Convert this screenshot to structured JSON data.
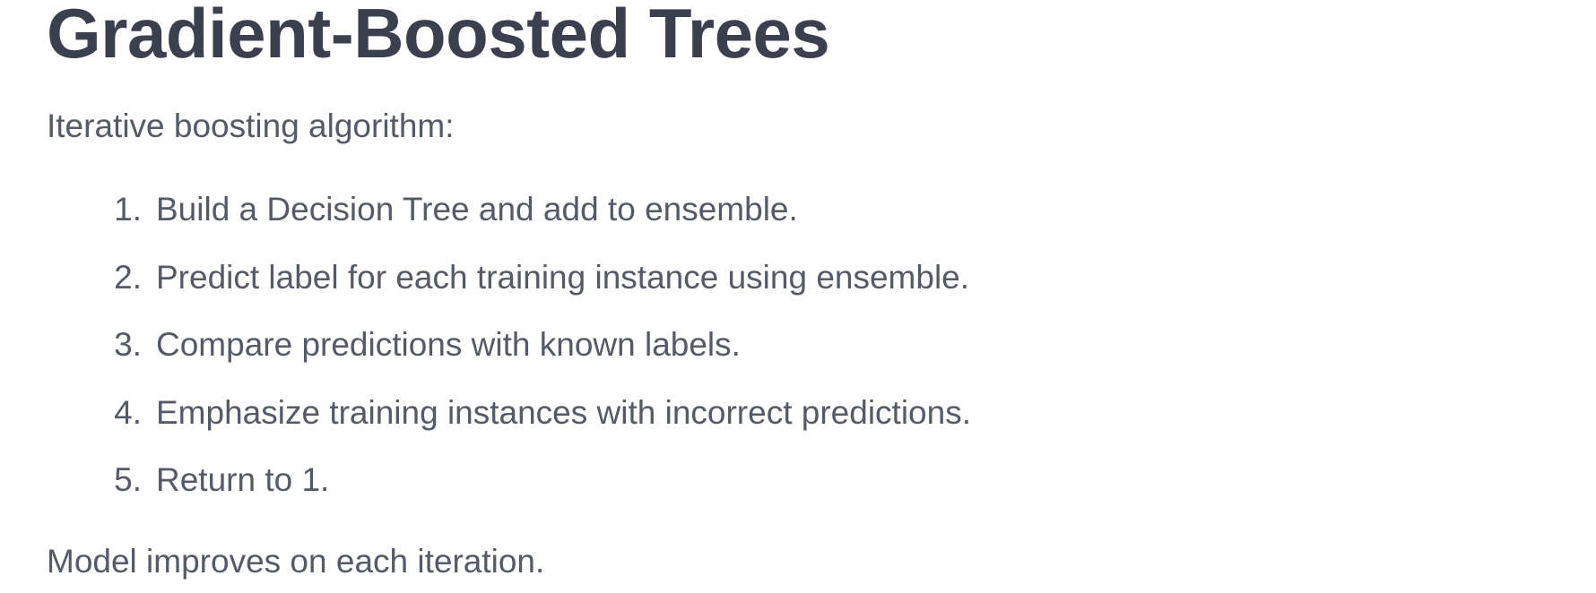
{
  "slide": {
    "title": "Gradient-Boosted Trees",
    "intro": "Iterative boosting algorithm:",
    "steps": [
      {
        "number": "1.",
        "text": "Build a Decision Tree and add to ensemble."
      },
      {
        "number": "2.",
        "text": "Predict label for each training instance using ensemble."
      },
      {
        "number": "3.",
        "text": "Compare predictions with known labels."
      },
      {
        "number": "4.",
        "text": "Emphasize training instances with incorrect predictions."
      },
      {
        "number": "5.",
        "text": "Return to 1."
      }
    ],
    "outro": "Model improves on each iteration."
  },
  "colors": {
    "title": "#3b3f4e",
    "body_text": "#555a66",
    "background": "#ffffff"
  }
}
